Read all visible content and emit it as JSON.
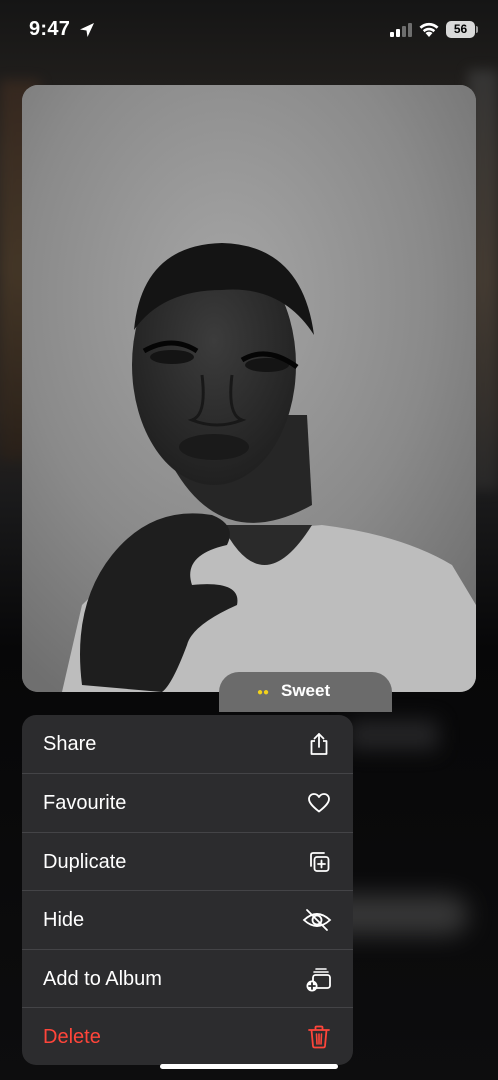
{
  "status_bar": {
    "time": "9:47",
    "battery": "56"
  },
  "photo": {
    "sticker_label": "Sweet"
  },
  "menu": {
    "items": [
      {
        "label": "Share",
        "icon": "share-icon"
      },
      {
        "label": "Favourite",
        "icon": "heart-icon"
      },
      {
        "label": "Duplicate",
        "icon": "duplicate-icon"
      },
      {
        "label": "Hide",
        "icon": "eye-slash-icon"
      },
      {
        "label": "Add to Album",
        "icon": "add-to-album-icon"
      },
      {
        "label": "Delete",
        "icon": "trash-icon",
        "destructive": true
      }
    ]
  },
  "colors": {
    "menu_background": "#2c2c2e",
    "destructive": "#ff453a",
    "separator": "#444447"
  }
}
